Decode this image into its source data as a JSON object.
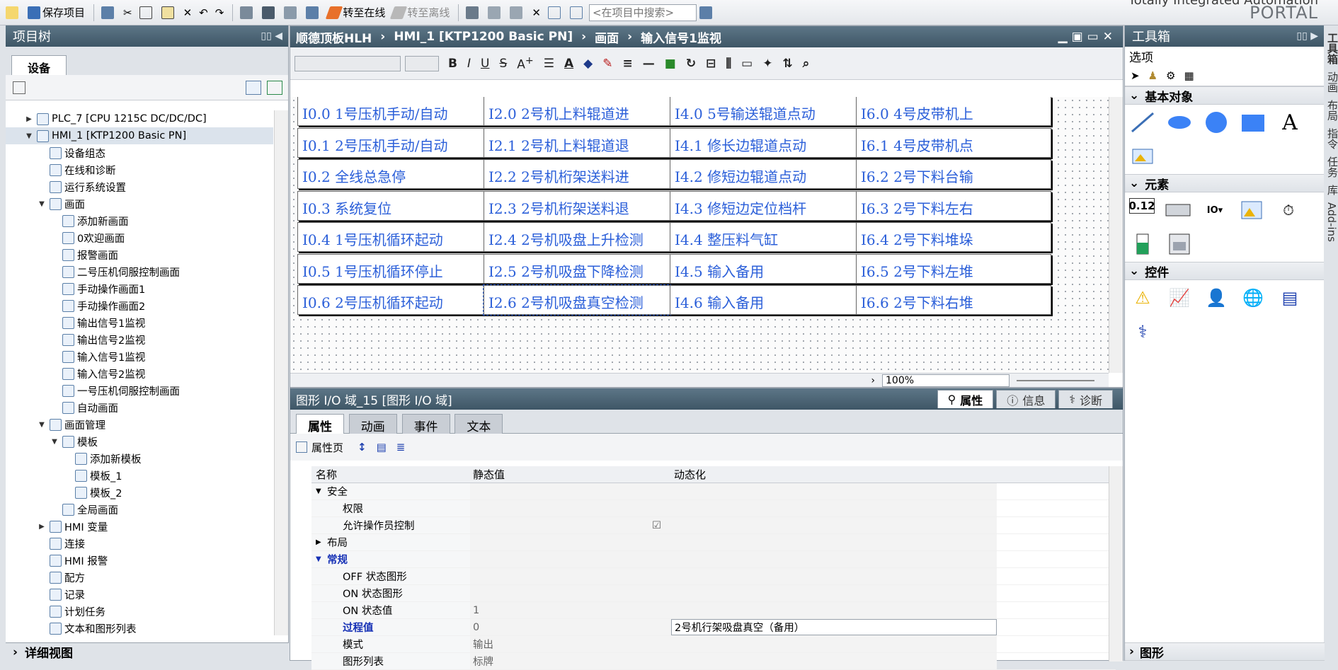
{
  "toolbar": {
    "save_project": "保存项目",
    "go_online": "转至在线",
    "go_offline": "转至离线",
    "search_placeholder": "<在项目中搜索>"
  },
  "brand": {
    "line1": "Totally Integrated Automation",
    "line2": "PORTAL"
  },
  "project_tree": {
    "title": "项目树",
    "tab": "设备",
    "items": [
      {
        "label": "PLC_7 [CPU 1215C DC/DC/DC]",
        "level": 1,
        "expander": "▶"
      },
      {
        "label": "HMI_1 [KTP1200 Basic PN]",
        "level": 1,
        "expander": "▼"
      },
      {
        "label": "设备组态",
        "level": 2,
        "expander": ""
      },
      {
        "label": "在线和诊断",
        "level": 2,
        "expander": ""
      },
      {
        "label": "运行系统设置",
        "level": 2,
        "expander": ""
      },
      {
        "label": "画面",
        "level": 2,
        "expander": "▼"
      },
      {
        "label": "添加新画面",
        "level": 3,
        "expander": ""
      },
      {
        "label": "0欢迎画面",
        "level": 3,
        "expander": ""
      },
      {
        "label": "报警画面",
        "level": 3,
        "expander": ""
      },
      {
        "label": "二号压机伺服控制画面",
        "level": 3,
        "expander": ""
      },
      {
        "label": "手动操作画面1",
        "level": 3,
        "expander": ""
      },
      {
        "label": "手动操作画面2",
        "level": 3,
        "expander": ""
      },
      {
        "label": "输出信号1监视",
        "level": 3,
        "expander": ""
      },
      {
        "label": "输出信号2监视",
        "level": 3,
        "expander": ""
      },
      {
        "label": "输入信号1监视",
        "level": 3,
        "expander": ""
      },
      {
        "label": "输入信号2监视",
        "level": 3,
        "expander": ""
      },
      {
        "label": "一号压机伺服控制画面",
        "level": 3,
        "expander": ""
      },
      {
        "label": "自动画面",
        "level": 3,
        "expander": ""
      },
      {
        "label": "画面管理",
        "level": 2,
        "expander": "▼"
      },
      {
        "label": "模板",
        "level": 3,
        "expander": "▼"
      },
      {
        "label": "添加新模板",
        "level": 4,
        "expander": ""
      },
      {
        "label": "模板_1",
        "level": 4,
        "expander": ""
      },
      {
        "label": "模板_2",
        "level": 4,
        "expander": ""
      },
      {
        "label": "全局画面",
        "level": 3,
        "expander": ""
      },
      {
        "label": "HMI 变量",
        "level": 2,
        "expander": "▶"
      },
      {
        "label": "连接",
        "level": 2,
        "expander": ""
      },
      {
        "label": "HMI 报警",
        "level": 2,
        "expander": ""
      },
      {
        "label": "配方",
        "level": 2,
        "expander": ""
      },
      {
        "label": "记录",
        "level": 2,
        "expander": ""
      },
      {
        "label": "计划任务",
        "level": 2,
        "expander": ""
      },
      {
        "label": "文本和图形列表",
        "level": 2,
        "expander": ""
      }
    ],
    "detail_view": "详细视图"
  },
  "editor": {
    "breadcrumb": [
      "顺德顶板HLH",
      "HMI_1 [KTP1200 Basic PN]",
      "画面",
      "输入信号1监视"
    ],
    "zoom": "100%",
    "io_columns": [
      [
        "I0.0 1号压机手动/自动",
        "I0.1 2号压机手动/自动",
        "I0.2 全线总急停",
        "I0.3 系统复位",
        "I0.4 1号压机循环起动",
        "I0.5 1号压机循环停止",
        "I0.6 2号压机循环起动"
      ],
      [
        "I2.0 2号机上料辊道进",
        "I2.1 2号机上料辊道退",
        "I2.2 2号机桁架送料进",
        "I2.3 2号机桁架送料退",
        "I2.4 2号机吸盘上升检测",
        "I2.5 2号机吸盘下降检测",
        "I2.6 2号机吸盘真空检测"
      ],
      [
        "I4.0 5号输送辊道点动",
        "I4.1 修长边辊道点动",
        "I4.2 修短边辊道点动",
        "I4.3 修短边定位档杆",
        "I4.4 整压料气缸",
        "I4.5 输入备用",
        "I4.6 输入备用"
      ],
      [
        "I6.0 4号皮带机上",
        "I6.1 4号皮带机点",
        "I6.2 2号下料台输",
        "I6.3 2号下料左右",
        "I6.4 2号下料堆垛",
        "I6.5 2号下料左堆",
        "I6.6 2号下料右堆"
      ]
    ]
  },
  "inspector": {
    "title": "图形 I/O 域_15 [图形 I/O 域]",
    "right_tabs": [
      "属性",
      "信息",
      "诊断"
    ],
    "sub_tabs": [
      "属性",
      "动画",
      "事件",
      "文本"
    ],
    "property_page": "属性页",
    "columns": [
      "名称",
      "静态值",
      "动态化"
    ],
    "rows": [
      {
        "name": "安全",
        "static": "",
        "dynamic": "",
        "expander": "▼",
        "bold": false
      },
      {
        "name": "权限",
        "static": "",
        "dynamic": "",
        "expander": "",
        "bold": false
      },
      {
        "name": "允许操作员控制",
        "static": "☑",
        "dynamic": "",
        "expander": "",
        "bold": false
      },
      {
        "name": "布局",
        "static": "",
        "dynamic": "",
        "expander": "▶",
        "bold": false
      },
      {
        "name": "常规",
        "static": "",
        "dynamic": "",
        "expander": "▼",
        "bold": true
      },
      {
        "name": "OFF 状态图形",
        "static": "",
        "dynamic": "",
        "expander": "",
        "bold": false
      },
      {
        "name": "ON 状态图形",
        "static": "",
        "dynamic": "",
        "expander": "",
        "bold": false
      },
      {
        "name": "ON 状态值",
        "static": "1",
        "dynamic": "",
        "expander": "",
        "bold": false
      },
      {
        "name": "过程值",
        "static": "0",
        "dynamic": "2号机行架吸盘真空（备用）",
        "expander": "",
        "bold": true
      },
      {
        "name": "模式",
        "static": "输出",
        "dynamic": "",
        "expander": "",
        "bold": false
      },
      {
        "name": "图形列表",
        "static": "标牌",
        "dynamic": "",
        "expander": "",
        "bold": false
      }
    ]
  },
  "toolbox": {
    "title": "工具箱",
    "options": "选项",
    "sections": [
      "基本对象",
      "元素",
      "控件",
      "图形"
    ],
    "basic_text_icon": "A",
    "side_tabs": [
      "工具箱",
      "动画",
      "布局",
      "指令",
      "任务",
      "库",
      "Add-ins"
    ]
  }
}
